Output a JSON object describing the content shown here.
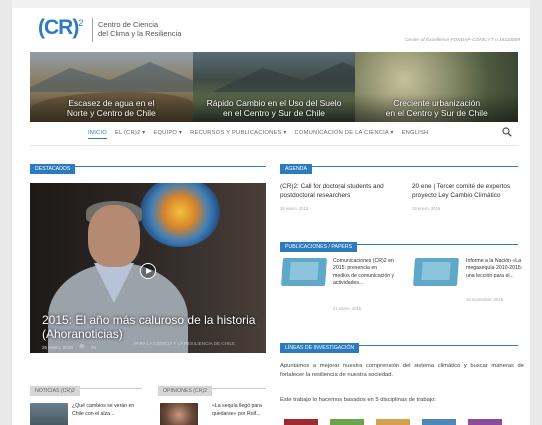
{
  "header": {
    "logo": "(CR)",
    "logo_sup": "2",
    "logo_line1": "Centro de Ciencia",
    "logo_line2": "del Clima y la Resiliencia",
    "coe": "Center of Excellence FONDAP-CONICYT n.15110009"
  },
  "banner": {
    "panels": [
      {
        "line1": "Escasez de agua en el",
        "line2": "Norte y Centro de Chile"
      },
      {
        "line1": "Rápido Cambio en el Uso del Suelo",
        "line2": "en el Centro y Sur de Chile"
      },
      {
        "line1": "Creciente urbanización",
        "line2": "en el Centro y Sur de Chile"
      }
    ]
  },
  "nav": {
    "items": [
      {
        "label": "INICIO"
      },
      {
        "label": "EL (CR)2 ▾"
      },
      {
        "label": "EQUIPO ▾"
      },
      {
        "label": "RECURSOS Y PUBLICACIONES ▾"
      },
      {
        "label": "COMUNICACIÓN DE LA CIENCIA ▾"
      },
      {
        "label": "ENGLISH"
      }
    ]
  },
  "destacados": {
    "heading": "DESTACADOS",
    "video_title_1": "2015: El año más caluroso de la historia",
    "video_title_2": "(Ahoranoticias)",
    "video_date": "25 enero, 2016",
    "video_views": "76",
    "video_watermark": "...PARA LA CIENCIA Y LA RESILIENCIA DE CHILE"
  },
  "agenda": {
    "heading": "AGENDA",
    "items": [
      {
        "text": "(CR)2: Call for doctoral students and postdoctoral researchers",
        "date": "26 enero, 2016"
      },
      {
        "text": "20 ene | Tercer comité de expertos proyecto Ley Cambio Climático",
        "date": "19 enero, 2016"
      }
    ]
  },
  "publicaciones": {
    "heading": "PUBLICACIONES / PAPERS",
    "items": [
      {
        "text": "Comunicaciones (CR)2 en 2015: presencia en medios de comunicación y actividades...",
        "date": "21 enero, 2016"
      },
      {
        "text": "Informe a la Nación «La megasequía 2010-2015: una lección para el...",
        "date": "18 noviembre, 2015"
      }
    ]
  },
  "lineas": {
    "heading": "LÍNEAS DE INVESTIGACIÓN",
    "paragraph": "Apuntamos a mejorar nuestra comprensión del sistema climático y buscar maneras de fortalecer la resiliencia de nuestra sociedad.",
    "paragraph2": "Este trabajo lo hacemos basados en 5 disciplinas de trabajo:"
  },
  "noticias": {
    "heading": "NOTICIAS (CR)2",
    "item_text": "¿Qué cambios se verán en Chile con el alza..."
  },
  "opiniones": {
    "heading": "OPINIONES (CR)2",
    "item_text": "«La sequía llegó para quedarse» por Rolf..."
  },
  "colors": {
    "accent": "#2d7bbf",
    "squares": [
      "#9c2a31",
      "#6aa34a",
      "#d3a24c",
      "#4d87b8",
      "#8b4b98"
    ]
  }
}
